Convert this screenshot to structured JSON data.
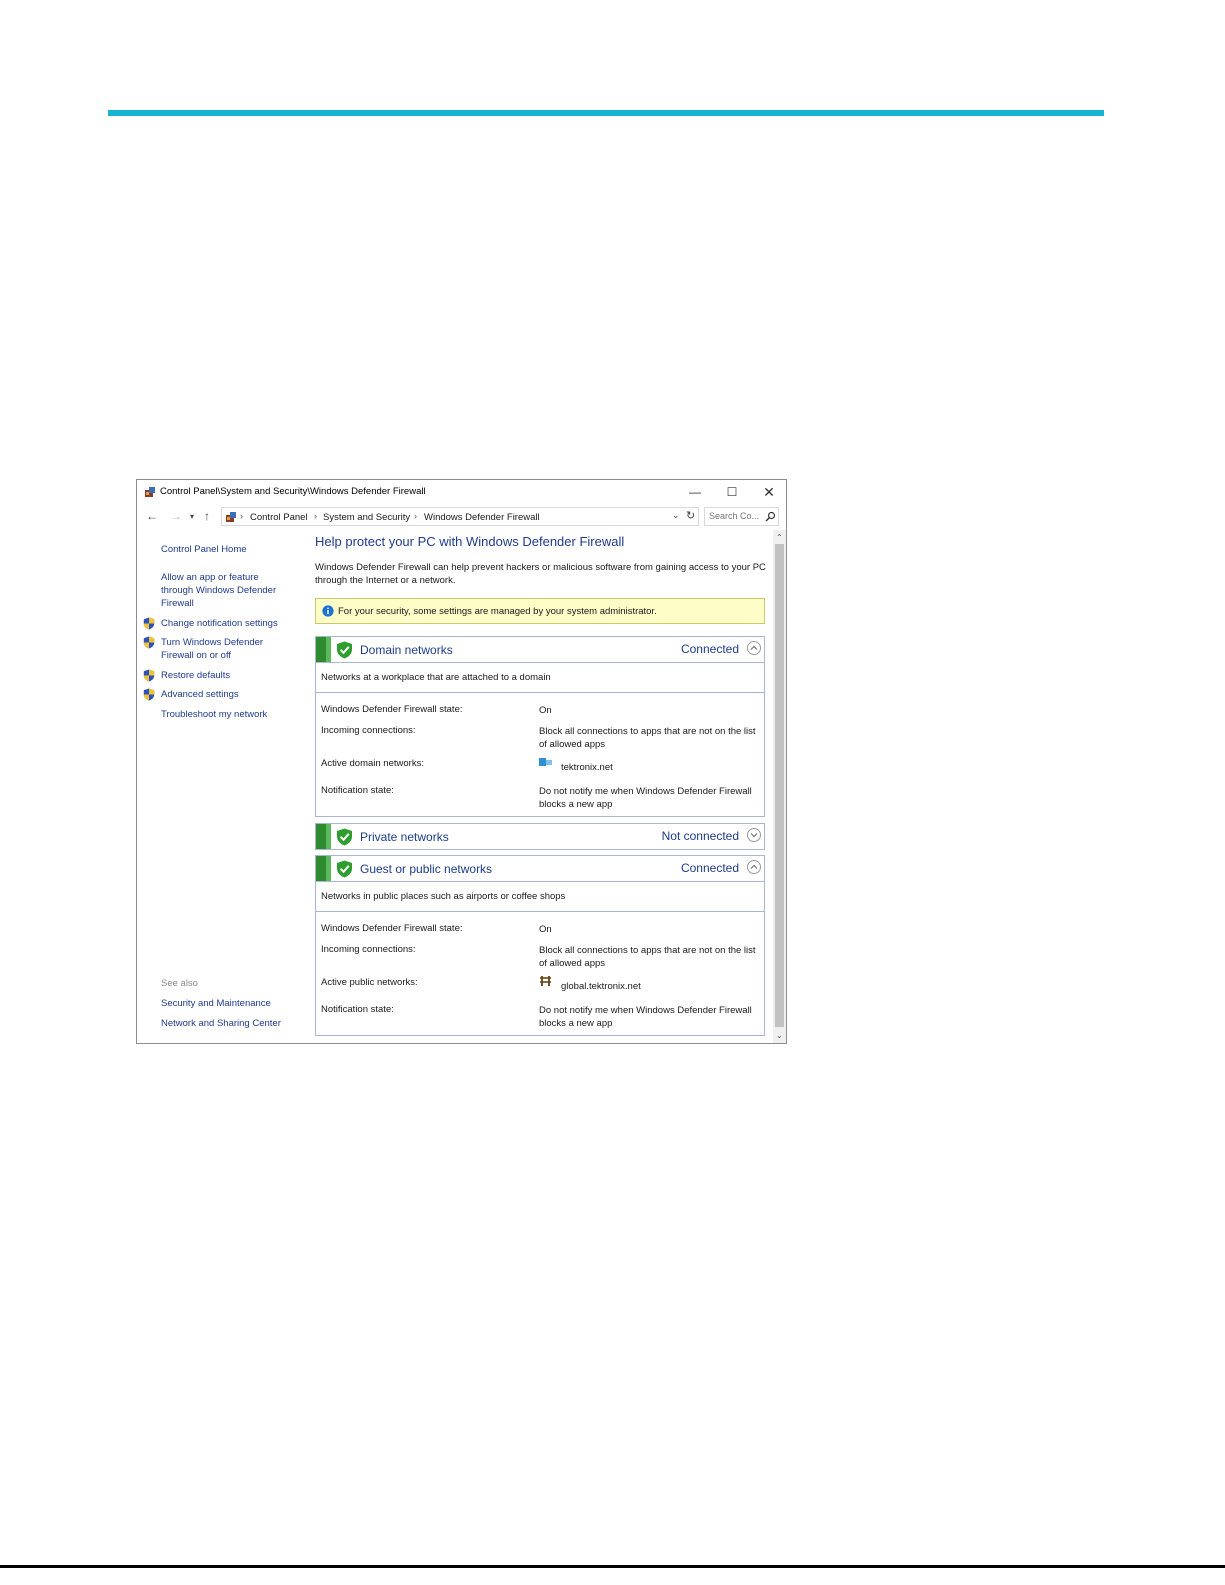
{
  "window": {
    "title": "Control Panel\\System and Security\\Windows Defender Firewall",
    "min_glyph": "—",
    "max_glyph": "☐",
    "close_glyph": "✕"
  },
  "address": {
    "back_glyph": "←",
    "forward_glyph": "→",
    "recent_glyph": "▾",
    "up_glyph": "↑",
    "breadcrumbs": [
      "Control Panel",
      "System and Security",
      "Windows Defender Firewall"
    ],
    "separator": "›",
    "dropdown_glyph": "⌄",
    "refresh_glyph": "↻",
    "search_placeholder": "Search Co..."
  },
  "sidebar": {
    "home": "Control Panel Home",
    "items": [
      "Allow an app or feature through Windows Defender Firewall",
      "Change notification settings",
      "Turn Windows Defender Firewall on or off",
      "Restore defaults",
      "Advanced settings",
      "Troubleshoot my network"
    ],
    "see_also_label": "See also",
    "see_also": [
      "Security and Maintenance",
      "Network and Sharing Center"
    ]
  },
  "main": {
    "title": "Help protect your PC with Windows Defender Firewall",
    "description": "Windows Defender Firewall can help prevent hackers or malicious software from gaining access to your PC through the Internet or a network.",
    "notice": "For your security, some settings are managed by your system administrator."
  },
  "networks": {
    "domain": {
      "name": "Domain networks",
      "status": "Connected",
      "description": "Networks at a workplace that are attached to a domain",
      "rows": [
        {
          "label": "Windows Defender Firewall state:",
          "value": "On"
        },
        {
          "label": "Incoming connections:",
          "value": "Block all connections to apps that are not on the list of allowed apps"
        },
        {
          "label": "Active domain networks:",
          "value": "tektronix.net"
        },
        {
          "label": "Notification state:",
          "value": "Do not notify me when Windows Defender Firewall blocks a new app"
        }
      ]
    },
    "private": {
      "name": "Private networks",
      "status": "Not connected"
    },
    "public": {
      "name": "Guest or public networks",
      "status": "Connected",
      "description": "Networks in public places such as airports or coffee shops",
      "rows": [
        {
          "label": "Windows Defender Firewall state:",
          "value": "On"
        },
        {
          "label": "Incoming connections:",
          "value": "Block all connections to apps that are not on the list of allowed apps"
        },
        {
          "label": "Active public networks:",
          "value": "global.tektronix.net"
        },
        {
          "label": "Notification state:",
          "value": "Do not notify me when Windows Defender Firewall blocks a new app"
        }
      ]
    }
  },
  "scrollbar": {
    "up_glyph": "⌃",
    "down_glyph": "⌄"
  },
  "colors": {
    "accent_bar": "#16b4d2",
    "link": "#1f3b8c",
    "shield_green": "#2e8b2e",
    "notice_bg": "#fdfdc8"
  }
}
